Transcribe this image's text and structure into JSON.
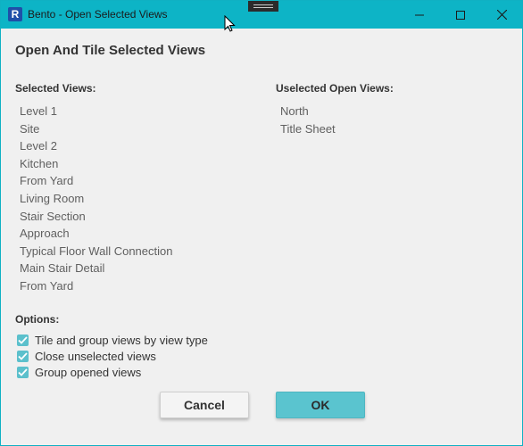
{
  "window": {
    "title": "Bento - Open Selected Views",
    "app_icon_letter": "R",
    "controls": [
      "minimize",
      "maximize",
      "close"
    ]
  },
  "dialog": {
    "heading": "Open And Tile Selected Views",
    "selected_label": "Selected Views:",
    "unselected_label": "Uselected Open Views:",
    "selected_views": [
      "Level 1",
      "Site",
      "Level 2",
      "Kitchen",
      "From Yard",
      "Living Room",
      "Stair Section",
      "Approach",
      "Typical Floor Wall Connection",
      "Main Stair Detail",
      "From Yard"
    ],
    "unselected_views": [
      "North",
      "Title Sheet"
    ],
    "options_label": "Options:",
    "options": [
      {
        "label": "Tile and group views by view type",
        "checked": true
      },
      {
        "label": "Close unselected views",
        "checked": true
      },
      {
        "label": "Group opened views",
        "checked": true
      }
    ],
    "cancel_label": "Cancel",
    "ok_label": "OK"
  },
  "colors": {
    "titlebar": "#0db4c6",
    "accent": "#5ac4cf",
    "background": "#f0f0f0"
  }
}
